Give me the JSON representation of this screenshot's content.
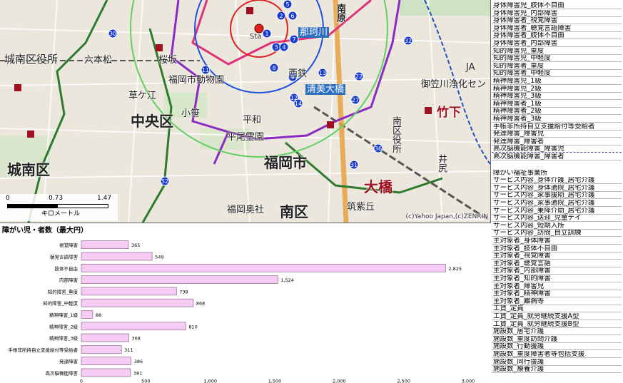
{
  "map": {
    "labels": {
      "jonan_kuyakusho": "城南区役所",
      "chuo_ku": "中央区",
      "jonan_ku": "城南区",
      "fukuoka_shi": "福岡市",
      "minami_ku": "南区",
      "ohashi": "大橋",
      "takeshita": "竹下",
      "doubutsuen": "福岡市動物園",
      "sakurazaka": "桜坂",
      "rokuhonmatsu": "六本松",
      "heiwa": "平和",
      "hirao_reien": "平尾霊園",
      "kusaga": "草ケ江",
      "koshi": "小笹",
      "fukuoka_okusha": "福岡奥社",
      "chikushi_oka": "筑紫丘",
      "sta": "Sta",
      "ja": "JA",
      "misasa_joka": "御笠川浄化セン",
      "nishitetsu": "西鉄",
      "seibi": "清美大橋",
      "sanmaru": "南区役所",
      "ijiri": "井尻",
      "minamibaru": "南原",
      "ohori_hata": "那珂川"
    },
    "scale_labels": [
      "0",
      "0.73",
      "1.47"
    ],
    "scale_unit": "キロメートル",
    "copyright": "(c)Yahoo Japan,(c)ZENRIN"
  },
  "side_panel": {
    "rows": [
      "身体障害児_肢体不自由",
      "身体障害児_内部障害",
      "身体障害者_視覚障害",
      "身体障害者_聴覚言語障害",
      "身体障害者_肢体不自由",
      "身体障害者_内部障害",
      "知的障害児_重度",
      "知的障害児_中軽度",
      "知的障害者_重度",
      "知的障害者_中軽度",
      "精神障害児_1級",
      "精神障害児_2級",
      "精神障害児_3級",
      "精神障害者_1級",
      "精神障害者_2級",
      "精神障害者_3級",
      "手帳非所持自立支援給付等受給者",
      "発達障害_障害児",
      "発達障害_障害者",
      "高次脳機能障害_障害児",
      "高次脳機能障害_障害者"
    ],
    "section2_title": "障がい福祉事業所",
    "rows2": [
      "サービス内容_身体介護_居宅介護",
      "サービス内容_身体通院_居宅介護",
      "サービス内容_家事援助_居宅介護",
      "サービス内容_家事通院_居宅介護",
      "サービス内容_乗降介助_居宅介護",
      "サービス内容_送迎_児童デイ",
      "サービス内容_短期入所",
      "サービス内容_訪問_自立訓練",
      "主対象者_身体障害",
      "主対象者_肢体不自由",
      "主対象者_視覚障害",
      "主対象者_聴覚言語",
      "主対象者_内部障害",
      "主対象者_知的障害",
      "主対象者_障害児",
      "主対象者_精神障害",
      "主対象者_難病等",
      "工賃_定員",
      "工賃_定員_就労継続支援A型",
      "工賃_定員_就労継続支援B型",
      "施設数_居宅介護",
      "施設数_重度訪問介護",
      "施設数_行動援護",
      "施設数_重度障害者等包括支援",
      "施設数_同行援護",
      "施設数_療養介護"
    ]
  },
  "chart_data": {
    "type": "bar",
    "orientation": "horizontal",
    "title": "障がい児・者数（最大円）",
    "categories": [
      "視覚障害",
      "聴覚言語障害",
      "肢体不自由",
      "内部障害",
      "知的障害_重度",
      "知的障害_中軽度",
      "精神障害_1級",
      "精神障害_2級",
      "精神障害_3級",
      "手帳非所持自立支援給付等受給者",
      "発達障害",
      "高次脳機能障害"
    ],
    "values": [
      365,
      549,
      2825,
      1524,
      738,
      868,
      88,
      810,
      368,
      311,
      386,
      381
    ],
    "value_labels": [
      "365",
      "549",
      "2,825",
      "1,524",
      "738",
      "868",
      "88",
      "810",
      "368",
      "311",
      "386",
      "381"
    ],
    "xticks": [
      "0",
      "500",
      "1,000",
      "1,500",
      "2,000",
      "2,500",
      "3,000"
    ],
    "xlim": [
      0,
      3000
    ],
    "bar_color": "#f6ccf4",
    "bar_border": "#8a6a8a"
  }
}
